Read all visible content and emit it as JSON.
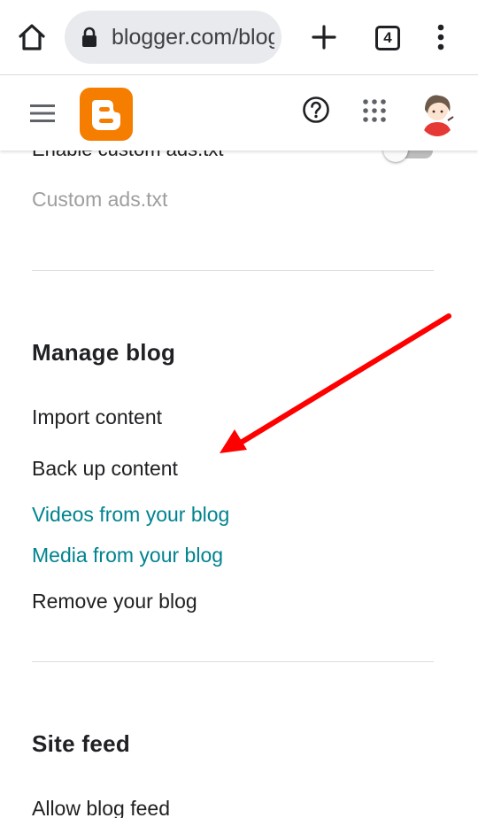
{
  "browser": {
    "url": "blogger.com/blog",
    "tab_count": "4"
  },
  "content": {
    "partial_setting_label": "Enable custom ads.txt",
    "partial_setting_toggle_on": false,
    "disabled_item": "Custom ads.txt",
    "manage_blog": {
      "heading": "Manage blog",
      "items": [
        "Import content",
        "Back up content",
        "Videos from your blog",
        "Media from your blog",
        "Remove your blog"
      ]
    },
    "site_feed": {
      "heading": "Site feed",
      "items": [
        "Allow blog feed"
      ]
    }
  },
  "colors": {
    "accent_link": "#00838f",
    "blogger_orange": "#f57d00",
    "annotation_arrow": "#ff0000"
  }
}
